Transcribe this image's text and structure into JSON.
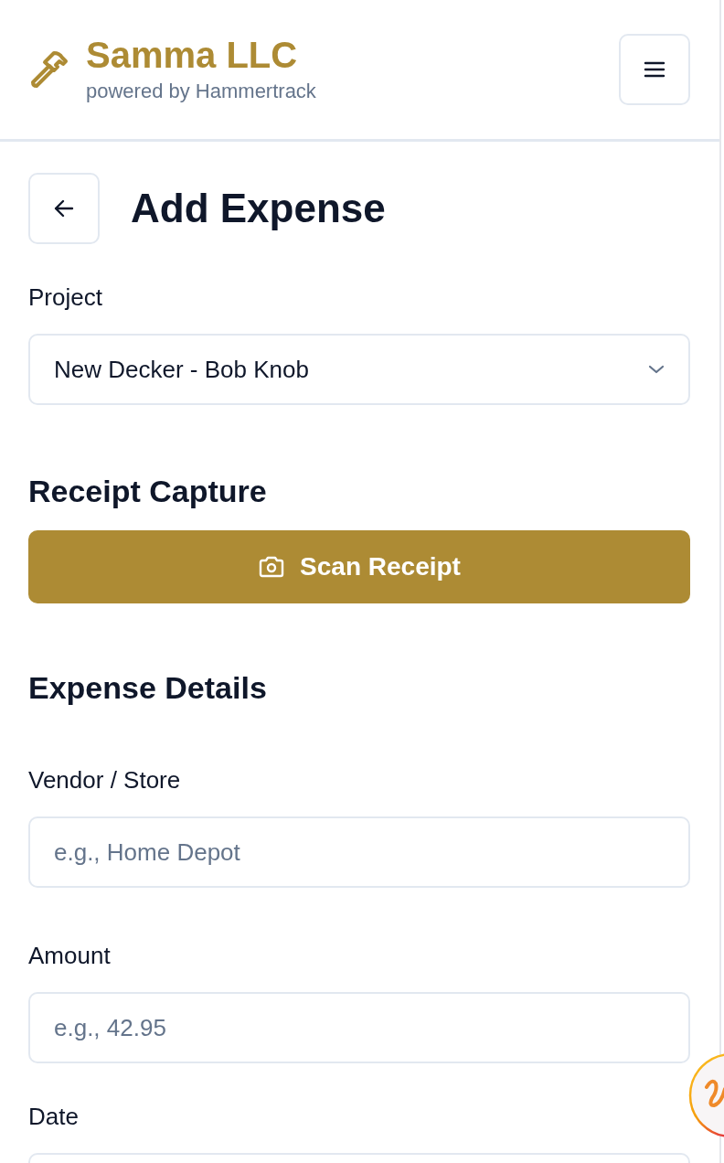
{
  "header": {
    "company": "Samma LLC",
    "tagline": "powered by Hammertrack"
  },
  "page": {
    "title": "Add Expense"
  },
  "project": {
    "label": "Project",
    "value": "New Decker - Bob Knob"
  },
  "receipt": {
    "heading": "Receipt Capture",
    "button": "Scan Receipt"
  },
  "details": {
    "heading": "Expense Details",
    "fields": [
      {
        "label": "Vendor / Store",
        "placeholder": "e.g., Home Depot"
      },
      {
        "label": "Amount",
        "placeholder": "e.g., 42.95"
      },
      {
        "label": "Date"
      }
    ]
  }
}
